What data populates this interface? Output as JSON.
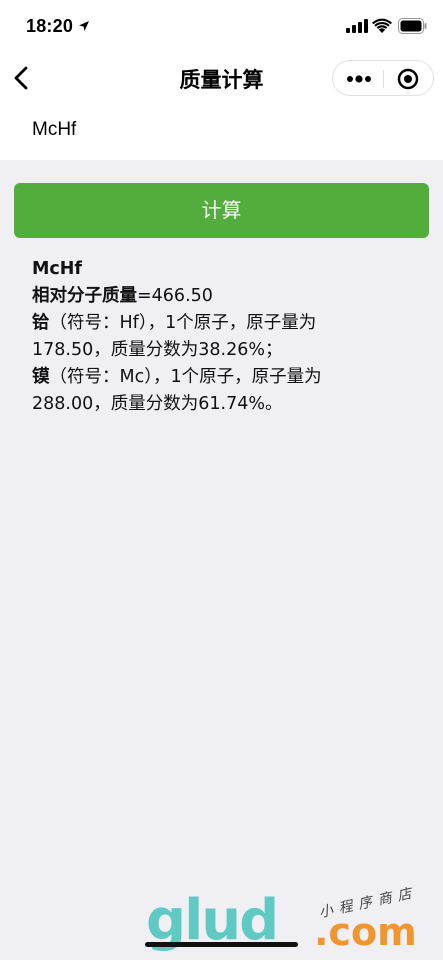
{
  "status_bar": {
    "time": "18:20"
  },
  "nav": {
    "title": "质量计算"
  },
  "input": {
    "value": "McHf"
  },
  "button": {
    "label": "计算"
  },
  "result": {
    "formula": "McHf",
    "mass_label": "相对分子质量",
    "mass_value": "=466.50",
    "el1_name": "铪",
    "el1_line1": "（符号：Hf），1个原子，原子量为",
    "el1_line2": "178.50，质量分数为38.26%；",
    "el2_name": "镆",
    "el2_line1": "（符号：Mc），1个原子，原子量为",
    "el2_line2": "288.00，质量分数为61.74%。"
  },
  "watermark": {
    "main": "glud",
    "dotcom": ".com",
    "tag": "小程序商店"
  },
  "colors": {
    "button_green": "#53ad3c",
    "watermark_teal": "#58c9c2",
    "watermark_orange": "#f0962e",
    "page_bg": "#f0eff4"
  }
}
